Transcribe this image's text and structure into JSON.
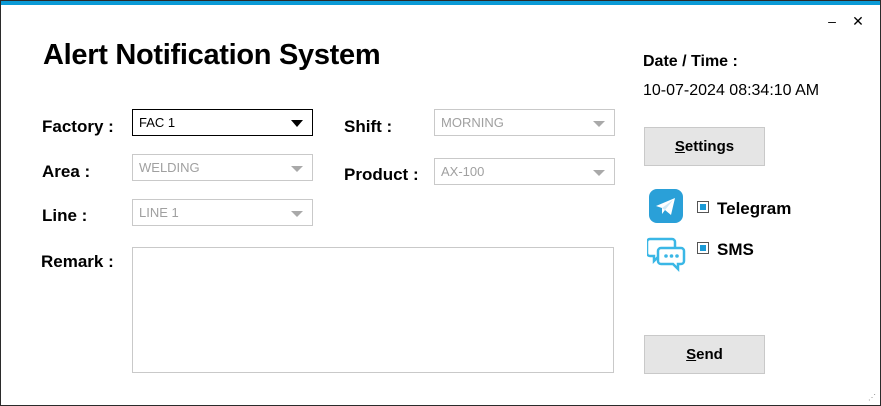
{
  "window": {
    "minimize_glyph": "–",
    "close_glyph": "✕"
  },
  "app": {
    "title": "Alert Notification System"
  },
  "form": {
    "factory": {
      "label": "Factory :",
      "value": "FAC 1"
    },
    "area": {
      "label": "Area :",
      "value": "WELDING"
    },
    "line": {
      "label": "Line :",
      "value": "LINE 1"
    },
    "shift": {
      "label": "Shift :",
      "value": "MORNING"
    },
    "product": {
      "label": "Product :",
      "value": "AX-100"
    },
    "remark": {
      "label": "Remark :",
      "value": ""
    }
  },
  "datetime": {
    "label": "Date / Time :",
    "value": "10-07-2024 08:34:10 AM"
  },
  "buttons": {
    "settings": {
      "mnemonic": "S",
      "rest": "ettings"
    },
    "send": {
      "mnemonic": "S",
      "rest": "end"
    }
  },
  "channels": [
    {
      "name": "Telegram",
      "checked": true,
      "icon": "telegram-icon"
    },
    {
      "name": "SMS",
      "checked": true,
      "icon": "sms-icon"
    }
  ],
  "colors": {
    "accent": "#0b9ad6",
    "telegram": "#2aa0d8",
    "sms": "#3ab7e6"
  }
}
